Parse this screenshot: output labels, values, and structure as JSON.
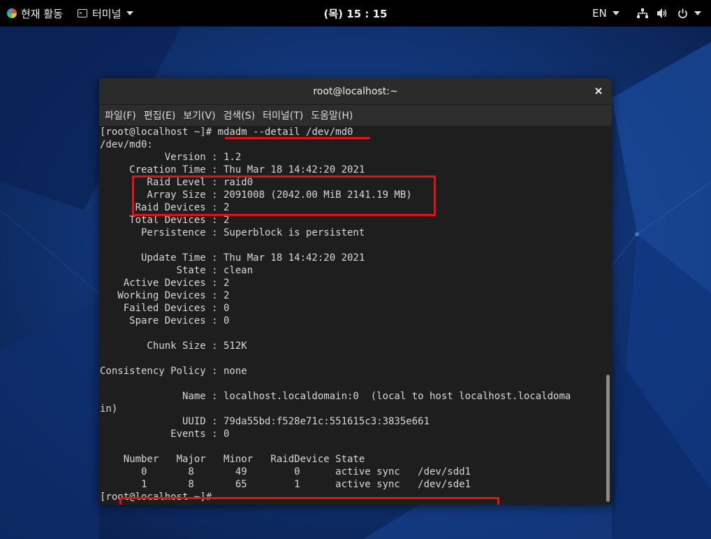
{
  "topbar": {
    "activities": "현재 활동",
    "app_menu": "터미널",
    "clock": "(목) 15 : 15",
    "lang": "EN"
  },
  "icons": {
    "network": "network-icon",
    "volume": "volume-icon",
    "power": "power-icon",
    "close": "close-icon"
  },
  "window": {
    "title": "root@localhost:~",
    "menu": [
      "파일(F)",
      "편집(E)",
      "보기(V)",
      "검색(S)",
      "터미널(T)",
      "도움말(H)"
    ]
  },
  "terminal": {
    "prompt": "[root@localhost ~]# ",
    "command": "mdadm --detail /dev/md0",
    "lines": [
      "/dev/md0:",
      "           Version : 1.2",
      "     Creation Time : Thu Mar 18 14:42:20 2021",
      "        Raid Level : raid0",
      "        Array Size : 2091008 (2042.00 MiB 2141.19 MB)",
      "      Raid Devices : 2",
      "     Total Devices : 2",
      "       Persistence : Superblock is persistent",
      "",
      "       Update Time : Thu Mar 18 14:42:20 2021",
      "             State : clean",
      "    Active Devices : 2",
      "   Working Devices : 2",
      "    Failed Devices : 0",
      "     Spare Devices : 0",
      "",
      "        Chunk Size : 512K",
      "",
      "Consistency Policy : none",
      "",
      "              Name : localhost.localdomain:0  (local to host localhost.localdoma",
      "in)",
      "              UUID : 79da55bd:f528e71c:551615c3:3835e661",
      "            Events : 0",
      "",
      "    Number   Major   Minor   RaidDevice State",
      "       0       8       49        0      active sync   /dev/sdd1",
      "       1       8       65        1      active sync   /dev/sde1"
    ],
    "final_prompt": "[root@localhost ~]#"
  },
  "colors": {
    "desktop": "#0c2a63",
    "highlight": "#e0121b",
    "terminal_bg": "#1e1e1e",
    "terminal_fg": "#d8d8d8"
  }
}
